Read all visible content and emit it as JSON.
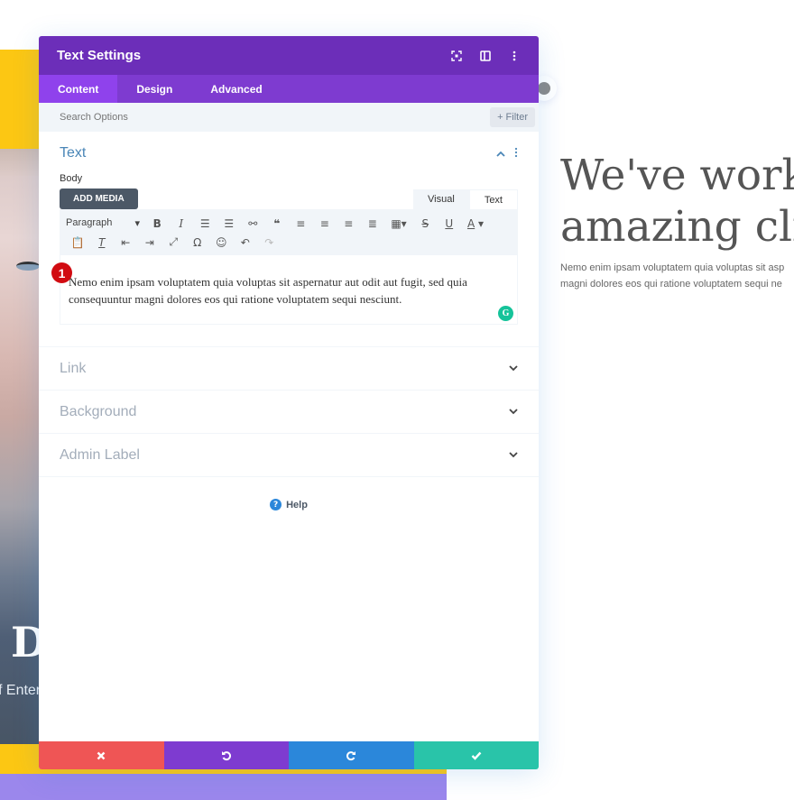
{
  "background": {
    "hero_title_lines": [
      "We've worke",
      "amazing cli"
    ],
    "hero_text_lines": [
      "Nemo enim ipsam voluptatem quia voluptas sit asp",
      "magni dolores eos qui ratione voluptatem sequi ne"
    ],
    "left_large_letter": "D",
    "left_subtext": "f Enter"
  },
  "modal": {
    "title": "Text Settings",
    "header_icons": [
      "fullscreen-icon",
      "split-view-icon",
      "more-options-icon"
    ],
    "tabs": [
      {
        "label": "Content",
        "active": true
      },
      {
        "label": "Design",
        "active": false
      },
      {
        "label": "Advanced",
        "active": false
      }
    ],
    "search": {
      "placeholder": "Search Options",
      "value": ""
    },
    "filter_label": "+ Filter",
    "text_section": {
      "title": "Text",
      "body_label": "Body",
      "add_media_label": "ADD MEDIA",
      "mode_tabs": [
        "Visual",
        "Text"
      ],
      "format_select": "Paragraph",
      "toolbar_row1": [
        "bold",
        "italic",
        "bullet-list",
        "numbered-list",
        "link",
        "blockquote",
        "align-left",
        "align-center",
        "align-right",
        "justify",
        "table",
        "strikethrough",
        "underline",
        "text-color"
      ],
      "toolbar_row2": [
        "paste-text",
        "clear-formatting",
        "outdent",
        "indent",
        "fullscreen",
        "special-character",
        "emoji",
        "undo",
        "redo"
      ],
      "content": "Nemo enim ipsam voluptatem quia voluptas sit aspernatur aut odit aut fugit, sed quia consequuntur magni dolores eos qui ratione voluptatem sequi nesciunt.",
      "step_badge": "1"
    },
    "collapsed_sections": [
      "Link",
      "Background",
      "Admin Label"
    ],
    "help_label": "Help",
    "footer_buttons": [
      {
        "name": "cancel",
        "color": "#ef5555"
      },
      {
        "name": "undo",
        "color": "#7e3bd0"
      },
      {
        "name": "redo",
        "color": "#2b87da"
      },
      {
        "name": "save",
        "color": "#29c4a9"
      }
    ]
  },
  "colors": {
    "header": "#6c2eb9",
    "tabs": "#7e3bd0",
    "active_tab": "#8f42ec",
    "accent_yellow": "#fcc713",
    "accent_lavender": "#9b87ec"
  }
}
